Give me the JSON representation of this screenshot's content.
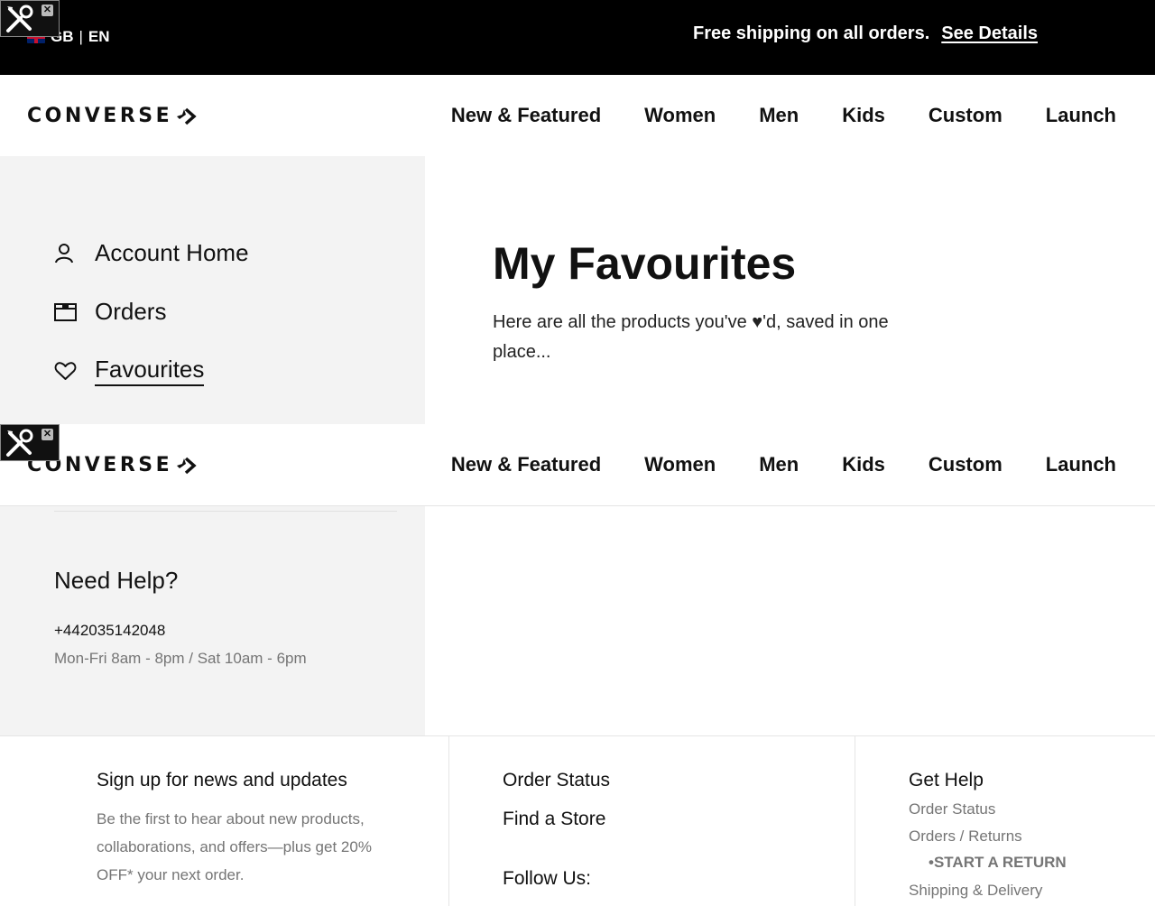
{
  "topbar": {
    "region": "GB",
    "separator": "|",
    "language": "EN",
    "promo_text": "Free shipping on all orders.",
    "promo_link": "See Details"
  },
  "brand": {
    "logo_text": "CONVERSE"
  },
  "nav": {
    "items": [
      "New & Featured",
      "Women",
      "Men",
      "Kids",
      "Custom",
      "Launch"
    ]
  },
  "sidebar": {
    "items": [
      {
        "label": "Account Home",
        "icon": "user-icon"
      },
      {
        "label": "Orders",
        "icon": "orders-box-icon"
      },
      {
        "label": "Favourites",
        "icon": "heart-icon",
        "active": true
      }
    ],
    "help": {
      "title": "Need Help?",
      "phone": "+442035142048",
      "hours": "Mon-Fri 8am - 8pm / Sat 10am - 6pm"
    }
  },
  "main": {
    "title": "My Favourites",
    "description": "Here are all the products you've ♥'d, saved in one place..."
  },
  "footer": {
    "signup_title": "Sign up for news and updates",
    "signup_text": "Be the first to hear about new products, collaborations, and offers—plus get 20% OFF* your next order.",
    "links": [
      "Order Status",
      "Find a Store",
      "Follow Us:"
    ],
    "get_help": {
      "title": "Get Help",
      "links": [
        "Order Status",
        "Orders / Returns",
        "Shipping & Delivery"
      ],
      "sub_link": "•START A RETURN"
    }
  },
  "colors": {
    "topbar_bg": "#000000",
    "sidebar_bg": "#f3f3f3",
    "muted_text": "#757575"
  }
}
